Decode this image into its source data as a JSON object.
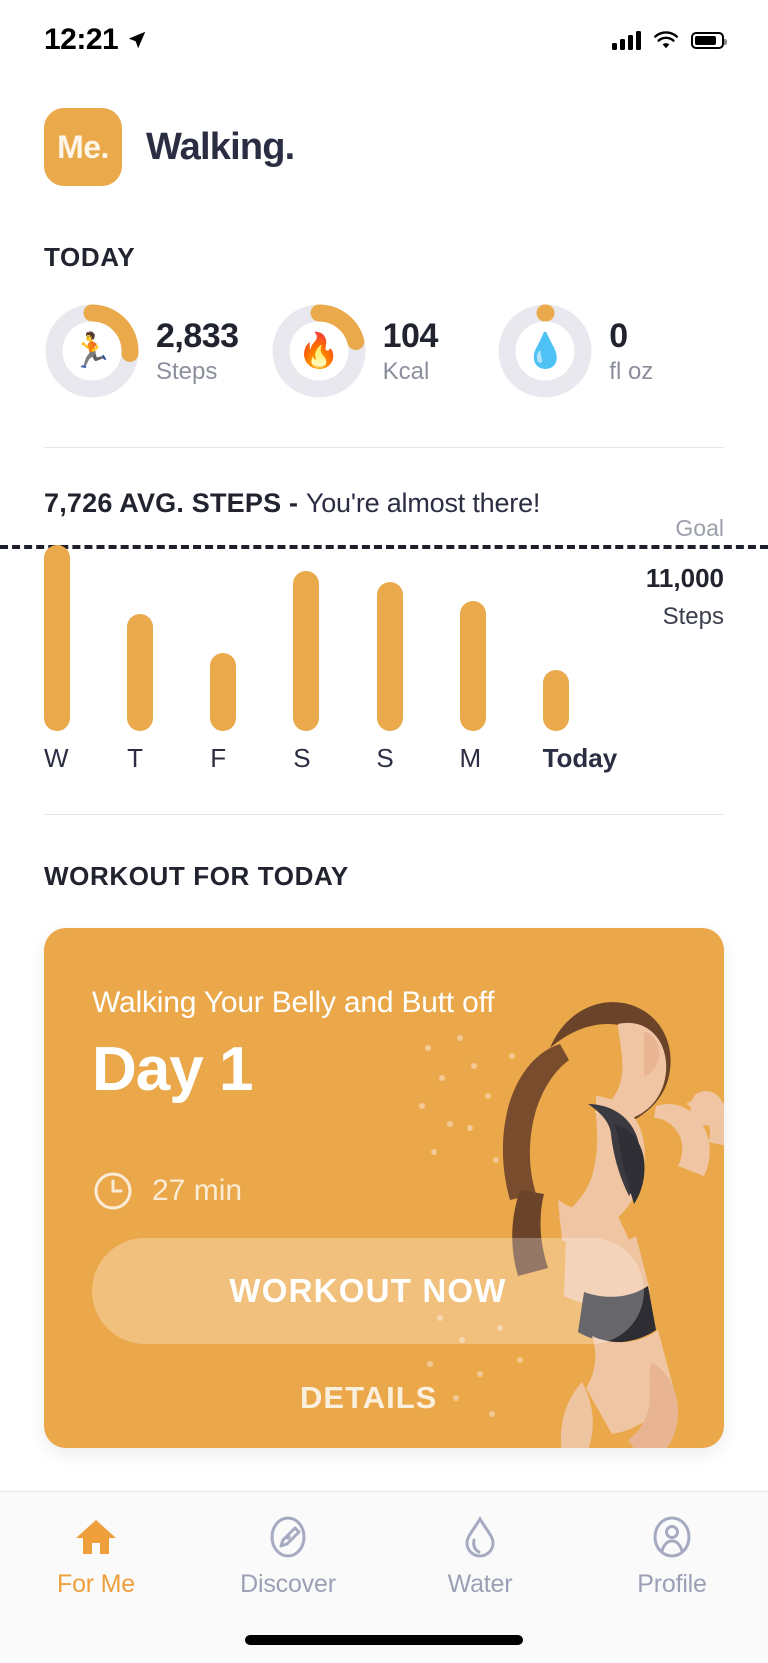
{
  "status_bar": {
    "time": "12:21",
    "location_icon": "location-arrow-icon",
    "signal_icon": "cellular-signal-icon",
    "wifi_icon": "wifi-icon",
    "battery_icon": "battery-icon"
  },
  "header": {
    "logo_text": "Me.",
    "title": "Walking.",
    "brand_color": "#eaa94a"
  },
  "today": {
    "section_title": "TODAY",
    "stats": [
      {
        "icon": "runner-icon",
        "emoji": "🏃",
        "value": "2,833",
        "unit": "Steps",
        "percent": 26
      },
      {
        "icon": "flame-icon",
        "emoji": "🔥",
        "value": "104",
        "unit": "Kcal",
        "percent": 21
      },
      {
        "icon": "water-drop-icon",
        "emoji": "💧",
        "value": "0",
        "unit": "fl oz",
        "percent": 4
      }
    ]
  },
  "chart_section": {
    "headline_bold": "7,726 AVG. STEPS - ",
    "headline_rest": "You're almost there!",
    "goal_label": "Goal",
    "goal_value": "11,000",
    "goal_unit": "Steps"
  },
  "chart_data": {
    "type": "bar",
    "title": "7,726 AVG. STEPS - You're almost there!",
    "categories": [
      "W",
      "T",
      "F",
      "S",
      "S",
      "M",
      "Today"
    ],
    "values": [
      11000,
      6900,
      4600,
      9500,
      8800,
      7700,
      3600
    ],
    "percent_of_goal": [
      100,
      63,
      42,
      86,
      80,
      70,
      33
    ],
    "goal": 11000,
    "goal_label": "Goal",
    "goal_unit": "Steps",
    "average": 7726,
    "xlabel": "",
    "ylabel": "Steps",
    "ylim": [
      0,
      11000
    ],
    "grid": false,
    "bar_color": "#eaa94a",
    "highlight_category": "Today"
  },
  "workout": {
    "section_title": "WORKOUT FOR TODAY",
    "name": "Walking Your Belly and Butt off",
    "day": "Day 1",
    "duration": "27 min",
    "clock_icon": "clock-icon",
    "primary_button": "WORKOUT NOW",
    "details_button": "DETAILS",
    "card_color": "#eaa84a"
  },
  "tabbar": {
    "items": [
      {
        "icon": "home-icon",
        "label": "For Me",
        "active": true
      },
      {
        "icon": "compass-icon",
        "label": "Discover",
        "active": false
      },
      {
        "icon": "water-drop-icon",
        "label": "Water",
        "active": false
      },
      {
        "icon": "profile-icon",
        "label": "Profile",
        "active": false
      }
    ],
    "active_color": "#ef9f3c",
    "inactive_color": "#9ba0b5"
  }
}
